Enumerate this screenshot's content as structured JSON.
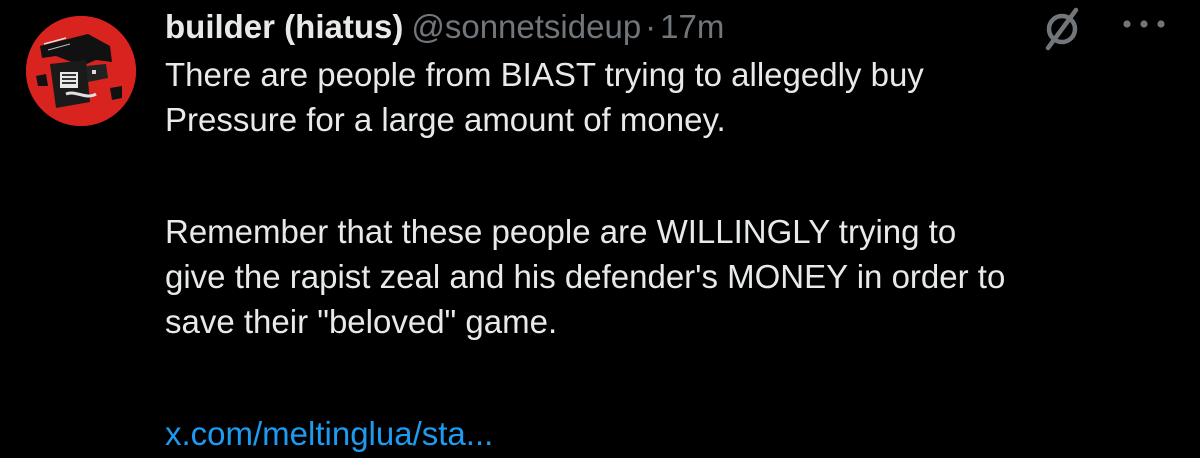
{
  "tweet": {
    "display_name": "builder (hiatus)",
    "handle": "@sonnetsideup",
    "separator": "·",
    "time": "17m",
    "paragraph1_line1": "There are people from BIAST trying to allegedly buy",
    "paragraph1_line2": "Pressure for a large amount of money.",
    "paragraph2_line1": "Remember that these people are WILLINGLY trying to",
    "paragraph2_line2": "give the rapist zeal and his defender's MONEY in order to",
    "paragraph2_line3": "save their \"beloved\" game.",
    "link_text": "x.com/meltinglua/sta...",
    "avatar_icon": "avatar-image",
    "action_icons": [
      "slash-circle-icon",
      "more-options-icon"
    ]
  },
  "colors": {
    "background": "#000000",
    "text": "#e7e9ea",
    "secondary": "#71767b",
    "link": "#1d9bf0",
    "avatar_red": "#d8231f"
  }
}
